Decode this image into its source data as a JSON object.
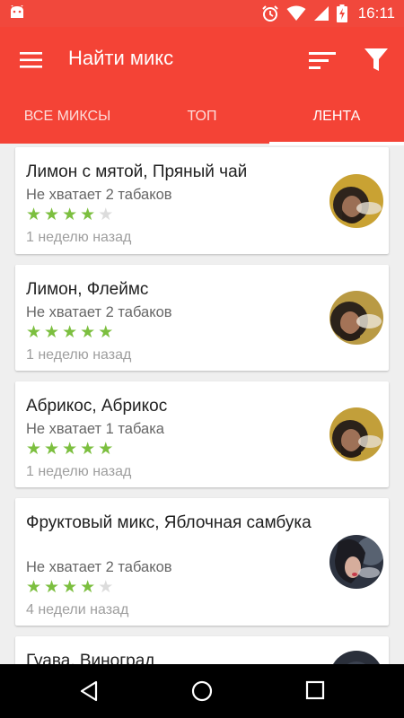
{
  "status_bar": {
    "time": "16:11"
  },
  "app_bar": {
    "title": "Найти микс"
  },
  "tabs": [
    {
      "label": "ВСЕ МИКСЫ",
      "active": false
    },
    {
      "label": "ТОП",
      "active": false
    },
    {
      "label": "ЛЕНТА",
      "active": true
    }
  ],
  "mixes": [
    {
      "title": "Лимон с мятой, Пряный чай",
      "missing": "Не хватает 2 табаков",
      "rating": 4,
      "max_rating": 5,
      "time": "1 неделю назад"
    },
    {
      "title": "Лимон, Флеймс",
      "missing": "Не хватает 2 табаков",
      "rating": 5,
      "max_rating": 5,
      "time": "1 неделю назад"
    },
    {
      "title": "Абрикос, Абрикос",
      "missing": "Не хватает 1 табака",
      "rating": 5,
      "max_rating": 5,
      "time": "1 неделю назад"
    },
    {
      "title": "Фруктовый микс, Яблочная самбука",
      "missing": "Не хватает 2 табаков",
      "rating": 4,
      "max_rating": 5,
      "time": "4 недели назад"
    },
    {
      "title": "Гуава, Виноград",
      "missing": "",
      "rating": 0,
      "max_rating": 5,
      "time": ""
    }
  ],
  "colors": {
    "primary": "#f44336",
    "status_bar": "#f1483c",
    "star_on": "#7cbf3f",
    "star_off": "#dcdcdc"
  }
}
